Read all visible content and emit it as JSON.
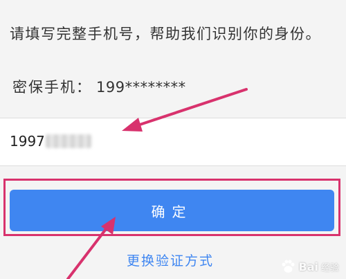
{
  "instruction": "请填写完整手机号，帮助我们识别你的身份。",
  "security_phone": {
    "label": "密保手机：",
    "masked_number": "199********"
  },
  "phone_input": {
    "value": "1997"
  },
  "confirm_button": {
    "label": "确定"
  },
  "switch_method": {
    "label": "更换验证方式"
  },
  "watermark": {
    "brand": "Bai",
    "suffix": "经验"
  },
  "colors": {
    "accent": "#3f86f1",
    "annotation": "#d8326d"
  }
}
